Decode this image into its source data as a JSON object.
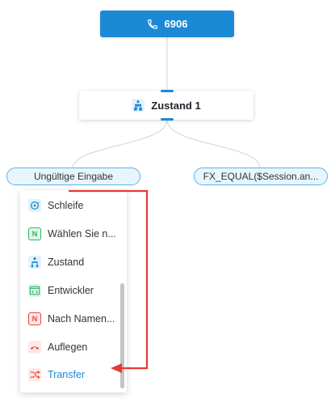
{
  "phone_node": {
    "label": "6906",
    "icon": "phone-icon"
  },
  "state_node": {
    "label": "Zustand 1",
    "icon": "state-flow-icon"
  },
  "branches": [
    {
      "label": "Ungültige Eingabe"
    },
    {
      "label": "FX_EQUAL($Session.an..."
    }
  ],
  "menu": {
    "items": [
      {
        "label": "Schleife",
        "icon": "loop-icon",
        "color": "#1a8ad6"
      },
      {
        "label": "Wählen Sie n...",
        "icon": "select-n-icon",
        "color": "#2fb36a"
      },
      {
        "label": "Zustand",
        "icon": "state-flow-icon",
        "color": "#1a8ad6"
      },
      {
        "label": "Entwickler",
        "icon": "code-icon",
        "color": "#2fb36a"
      },
      {
        "label": "Nach Namen...",
        "icon": "name-n-icon",
        "color": "#e8463c"
      },
      {
        "label": "Auflegen",
        "icon": "hangup-icon",
        "color": "#e8463c"
      },
      {
        "label": "Transfer",
        "icon": "transfer-icon",
        "color": "#e8463c",
        "active": true
      }
    ]
  },
  "colors": {
    "primary": "#1a8ad6",
    "annotation": "#e53935"
  }
}
